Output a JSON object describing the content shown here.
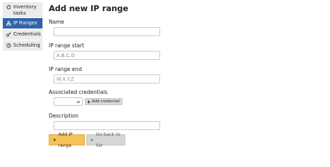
{
  "sidebar": {
    "items": [
      {
        "label": "Inventory tasks",
        "icon": "refresh-icon",
        "active": false
      },
      {
        "label": "IP Ranges",
        "icon": "sitemap-icon",
        "active": true
      },
      {
        "label": "Credentials",
        "icon": "key-icon",
        "active": false
      },
      {
        "label": "Scheduling",
        "icon": "clock-icon",
        "active": false
      }
    ]
  },
  "form": {
    "title": "Add new IP range",
    "name_label": "Name",
    "name_value": "",
    "ip_start_label": "IP range start",
    "ip_start_placeholder": "A.B.C.D",
    "ip_end_label": "IP range end",
    "ip_end_placeholder": "W.X.Y.Z",
    "credentials_label": "Associated credentials",
    "credentials_selected": "",
    "add_credential_label": "Add credential",
    "description_label": "Description",
    "description_value": ""
  },
  "actions": {
    "submit_label": "Add IP range",
    "back_label": "Go back to list"
  },
  "colors": {
    "active_sidebar": "#3163a8",
    "primary_button": "#f6c35a",
    "secondary_button": "#d6d6d6"
  }
}
